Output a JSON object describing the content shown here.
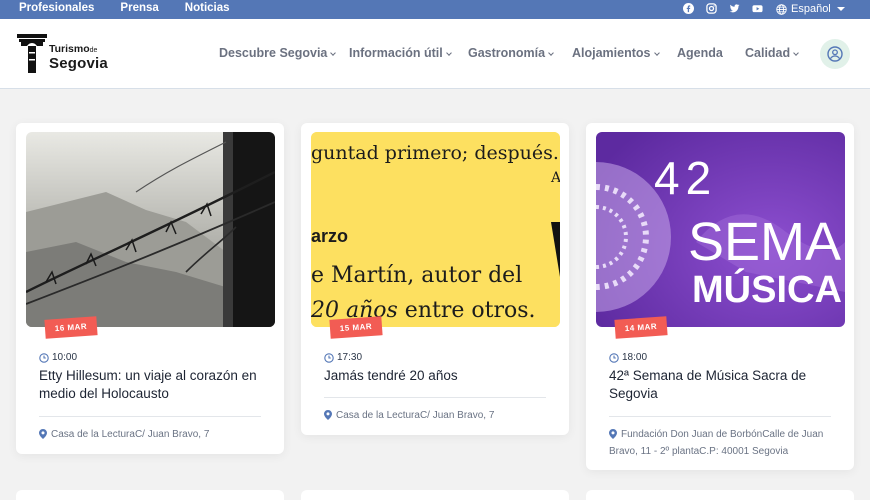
{
  "topbar": {
    "links": [
      "Profesionales",
      "Prensa",
      "Noticias"
    ],
    "social_icons": [
      "facebook-icon",
      "instagram-icon",
      "twitter-icon",
      "youtube-icon"
    ],
    "language": "Español"
  },
  "header": {
    "logo": {
      "line1": "Turismo",
      "line1_small": "de",
      "line2": "Segovia"
    },
    "nav": [
      {
        "label": "Descubre Segovia",
        "has_dropdown": true
      },
      {
        "label": "Información útil",
        "has_dropdown": true
      },
      {
        "label": "Gastronomía",
        "has_dropdown": true
      },
      {
        "label": "Alojamientos",
        "has_dropdown": true
      },
      {
        "label": "Agenda",
        "has_dropdown": false
      },
      {
        "label": "Calidad",
        "has_dropdown": true
      }
    ],
    "user_icon": "user-icon"
  },
  "events": [
    {
      "date": "16 MAR",
      "time": "10:00",
      "title": "Etty Hillesum: un viaje al corazón en medio del Holocausto",
      "place": "Casa de la LecturaC/ Juan Bravo, 7"
    },
    {
      "date": "15 MAR",
      "time": "17:30",
      "title": "Jamás tendré 20 años",
      "place": "Casa de la LecturaC/ Juan Bravo, 7",
      "image_text": {
        "line1": "guntad primero; después..",
        "line2": "arzo",
        "line3": "e Martín, autor del",
        "line4_italic": "20 años",
        "line4_rest": " entre otros."
      }
    },
    {
      "date": "14 MAR",
      "time": "18:00",
      "title": "42ª Semana de Música Sacra de Segovia",
      "place": "Fundación Don Juan de BorbónCalle de Juan Bravo, 11 - 2º plantaC.P: 40001 Segovia",
      "image_text": {
        "line1": "42",
        "line2": "SEMA",
        "line3": "MÚSICA"
      }
    }
  ],
  "colors": {
    "topbar": "#5477b6",
    "badge": "#f25c54",
    "accent_icon": "#5477b6",
    "card2_bg": "#fde060",
    "card3_bg": "#7b45c0"
  }
}
